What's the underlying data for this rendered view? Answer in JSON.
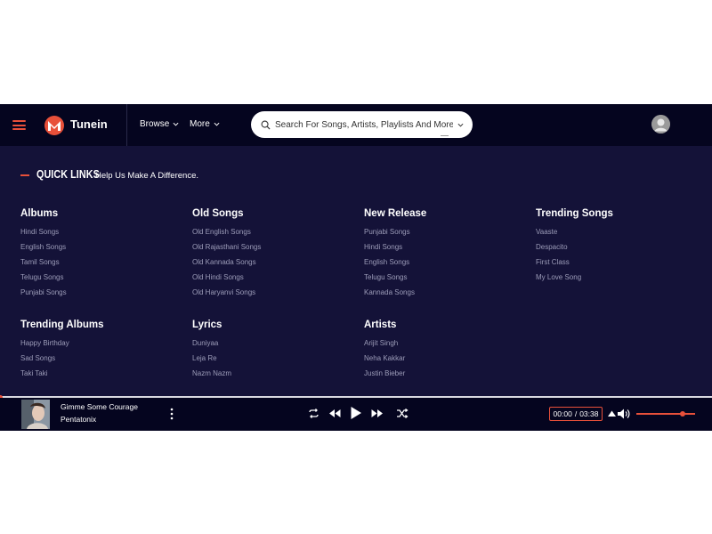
{
  "header": {
    "brand": "Tunein",
    "nav": {
      "browse": "Browse",
      "more": "More"
    },
    "search": {
      "placeholder": "Search For Songs, Artists, Playlists And More..",
      "value": ""
    }
  },
  "quick_links": {
    "title": "QUICK LINKS",
    "subtitle": "Help Us Make A Difference.",
    "columns": [
      {
        "heading": "Albums",
        "links": [
          "Hindi Songs",
          "English Songs",
          "Tamil Songs",
          "Telugu Songs",
          "Punjabi Songs"
        ]
      },
      {
        "heading": "Old Songs",
        "links": [
          "Old English Songs",
          "Old Rajasthani Songs",
          "Old Kannada Songs",
          "Old Hindi Songs",
          "Old Haryanvi Songs"
        ]
      },
      {
        "heading": "New Release",
        "links": [
          "Punjabi Songs",
          "Hindi Songs",
          "English Songs",
          "Telugu Songs",
          "Kannada Songs"
        ]
      },
      {
        "heading": "Trending Songs",
        "links": [
          "Vaaste",
          "Despacito",
          "First Class",
          "My Love Song"
        ]
      },
      {
        "heading": "Trending Albums",
        "links": [
          "Happy Birthday",
          "Sad Songs",
          "Taki Taki"
        ]
      },
      {
        "heading": "Lyrics",
        "links": [
          "Duniyaa",
          "Leja Re",
          "Nazm Nazm"
        ]
      },
      {
        "heading": "Artists",
        "links": [
          "Arijit Singh",
          "Neha Kakkar",
          "Justin Bieber"
        ]
      }
    ]
  },
  "player": {
    "track_title": "Gimme Some Courage",
    "artist": "Pentatonix",
    "current_time": "00:00",
    "separator": "/",
    "duration": "03:38",
    "progress": 0,
    "volume": 0.8,
    "icons": [
      "repeat-icon",
      "previous-icon",
      "play-icon",
      "next-icon",
      "shuffle-icon",
      "volume-icon"
    ]
  },
  "colors": {
    "accent": "#e8503a",
    "header_bg": "#05051f",
    "panel_bg": "#141238",
    "link": "#9c9cb8"
  }
}
